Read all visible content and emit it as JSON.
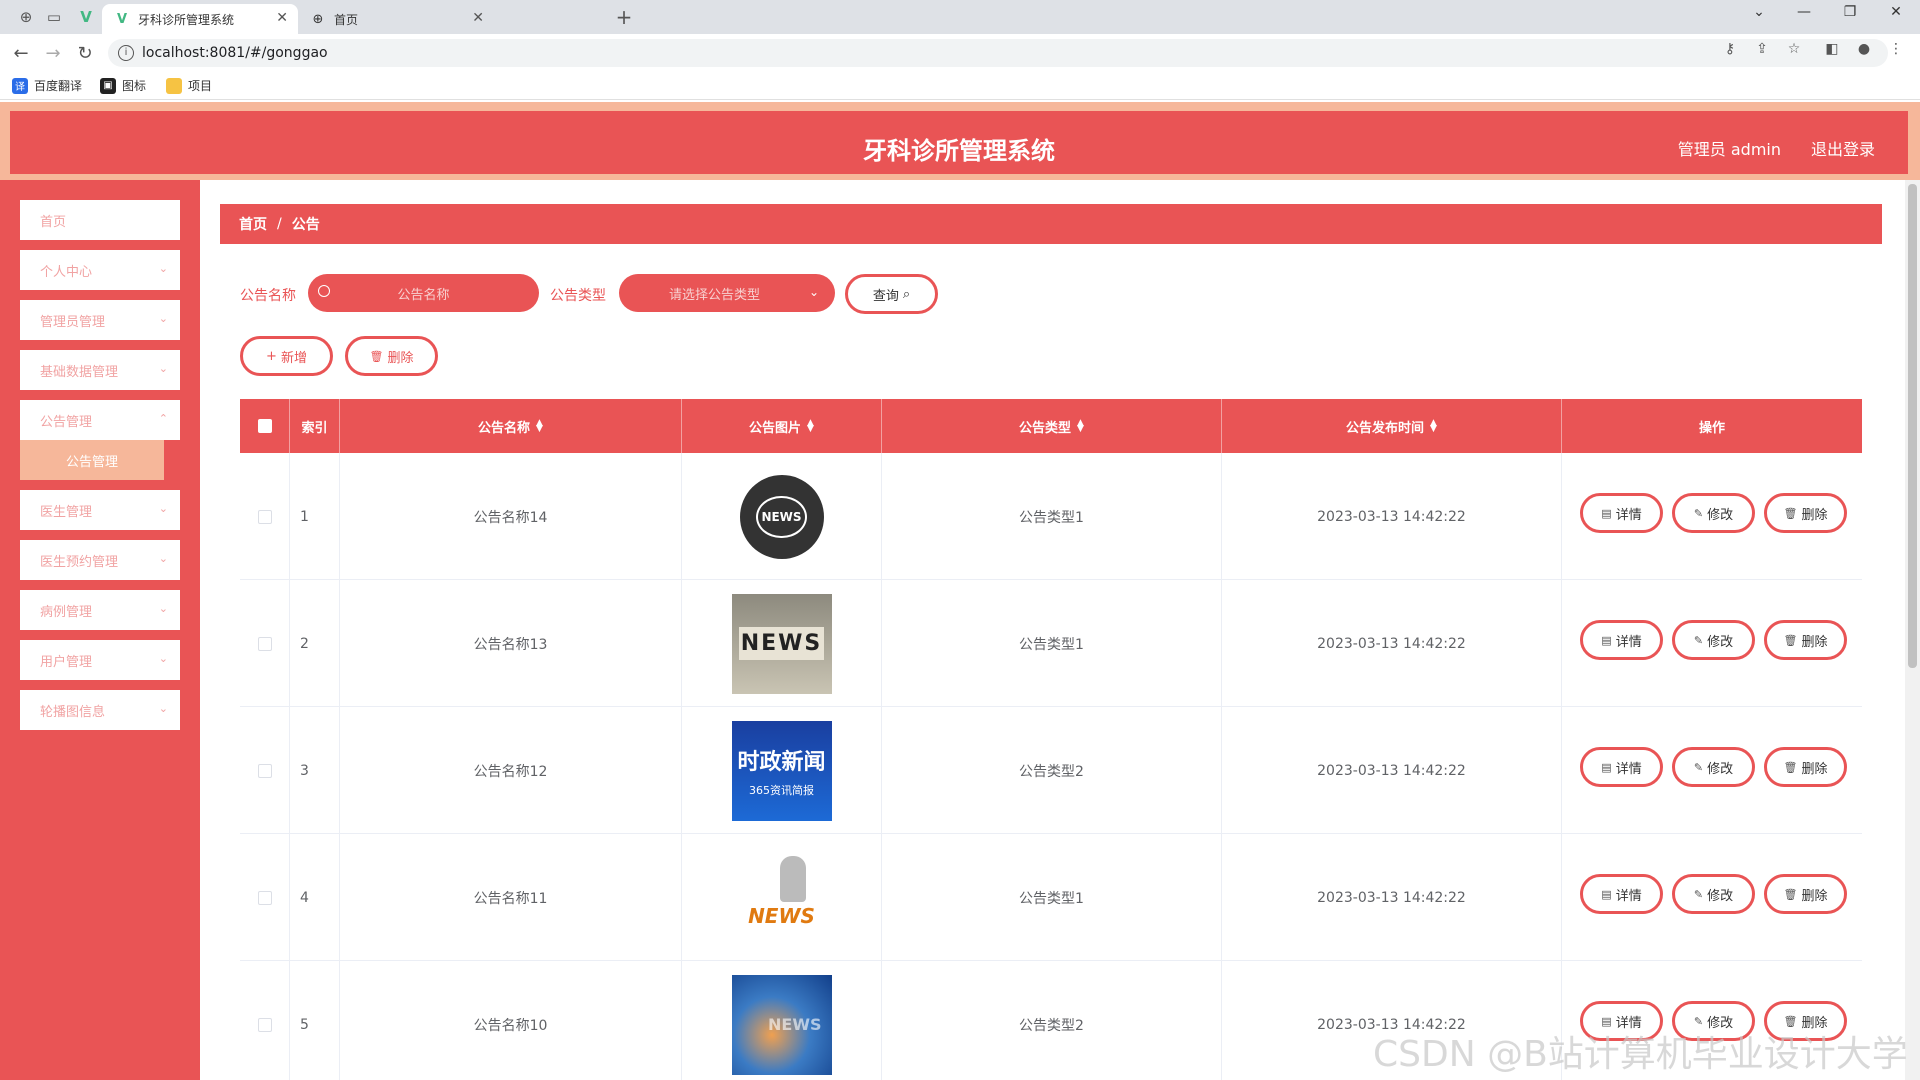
{
  "browser": {
    "tabs": [
      {
        "label": "牙科诊所管理系统",
        "active": true
      },
      {
        "label": "首页",
        "active": false
      }
    ],
    "url": "localhost:8081/#/gonggao",
    "bookmarks": [
      {
        "label": "百度翻译",
        "icon": "translate-icon"
      },
      {
        "label": "图标",
        "icon": "image-icon"
      },
      {
        "label": "项目",
        "icon": "folder-icon"
      }
    ]
  },
  "header": {
    "title": "牙科诊所管理系统",
    "user": "管理员 admin",
    "logout": "退出登录"
  },
  "sidebar": {
    "items": [
      {
        "label": "首页"
      },
      {
        "label": "个人中心"
      },
      {
        "label": "管理员管理"
      },
      {
        "label": "基础数据管理"
      },
      {
        "label": "公告管理"
      },
      {
        "label": "医生管理"
      },
      {
        "label": "医生预约管理"
      },
      {
        "label": "病例管理"
      },
      {
        "label": "用户管理"
      },
      {
        "label": "轮播图信息"
      }
    ],
    "active_sub": "公告管理"
  },
  "breadcrumb": {
    "home": "首页",
    "sep": "/",
    "current": "公告"
  },
  "filters": {
    "name_label": "公告名称",
    "name_placeholder": "公告名称",
    "type_label": "公告类型",
    "type_placeholder": "请选择公告类型",
    "query": "查询"
  },
  "actions": {
    "add": "新增",
    "delete": "删除"
  },
  "table": {
    "columns": [
      "索引",
      "公告名称",
      "公告图片",
      "公告类型",
      "公告发布时间",
      "操作"
    ],
    "rows": [
      {
        "index": "1",
        "name": "公告名称14",
        "type": "公告类型1",
        "time": "2023-03-13 14:42:22",
        "img": "NEWS"
      },
      {
        "index": "2",
        "name": "公告名称13",
        "type": "公告类型1",
        "time": "2023-03-13 14:42:22",
        "img": "NEWS"
      },
      {
        "index": "3",
        "name": "公告名称12",
        "type": "公告类型2",
        "time": "2023-03-13 14:42:22",
        "img": "时政新闻",
        "img_sub": "365资讯简报"
      },
      {
        "index": "4",
        "name": "公告名称11",
        "type": "公告类型1",
        "time": "2023-03-13 14:42:22",
        "img": "NEWS"
      },
      {
        "index": "5",
        "name": "公告名称10",
        "type": "公告类型2",
        "time": "2023-03-13 14:42:22",
        "img": "NEWS"
      }
    ],
    "row_actions": {
      "detail": "详情",
      "edit": "修改",
      "delete": "删除"
    }
  },
  "watermark": "CSDN @B站计算机毕业设计大学",
  "colors": {
    "primary": "#e95455",
    "accent": "#f6b79a"
  }
}
